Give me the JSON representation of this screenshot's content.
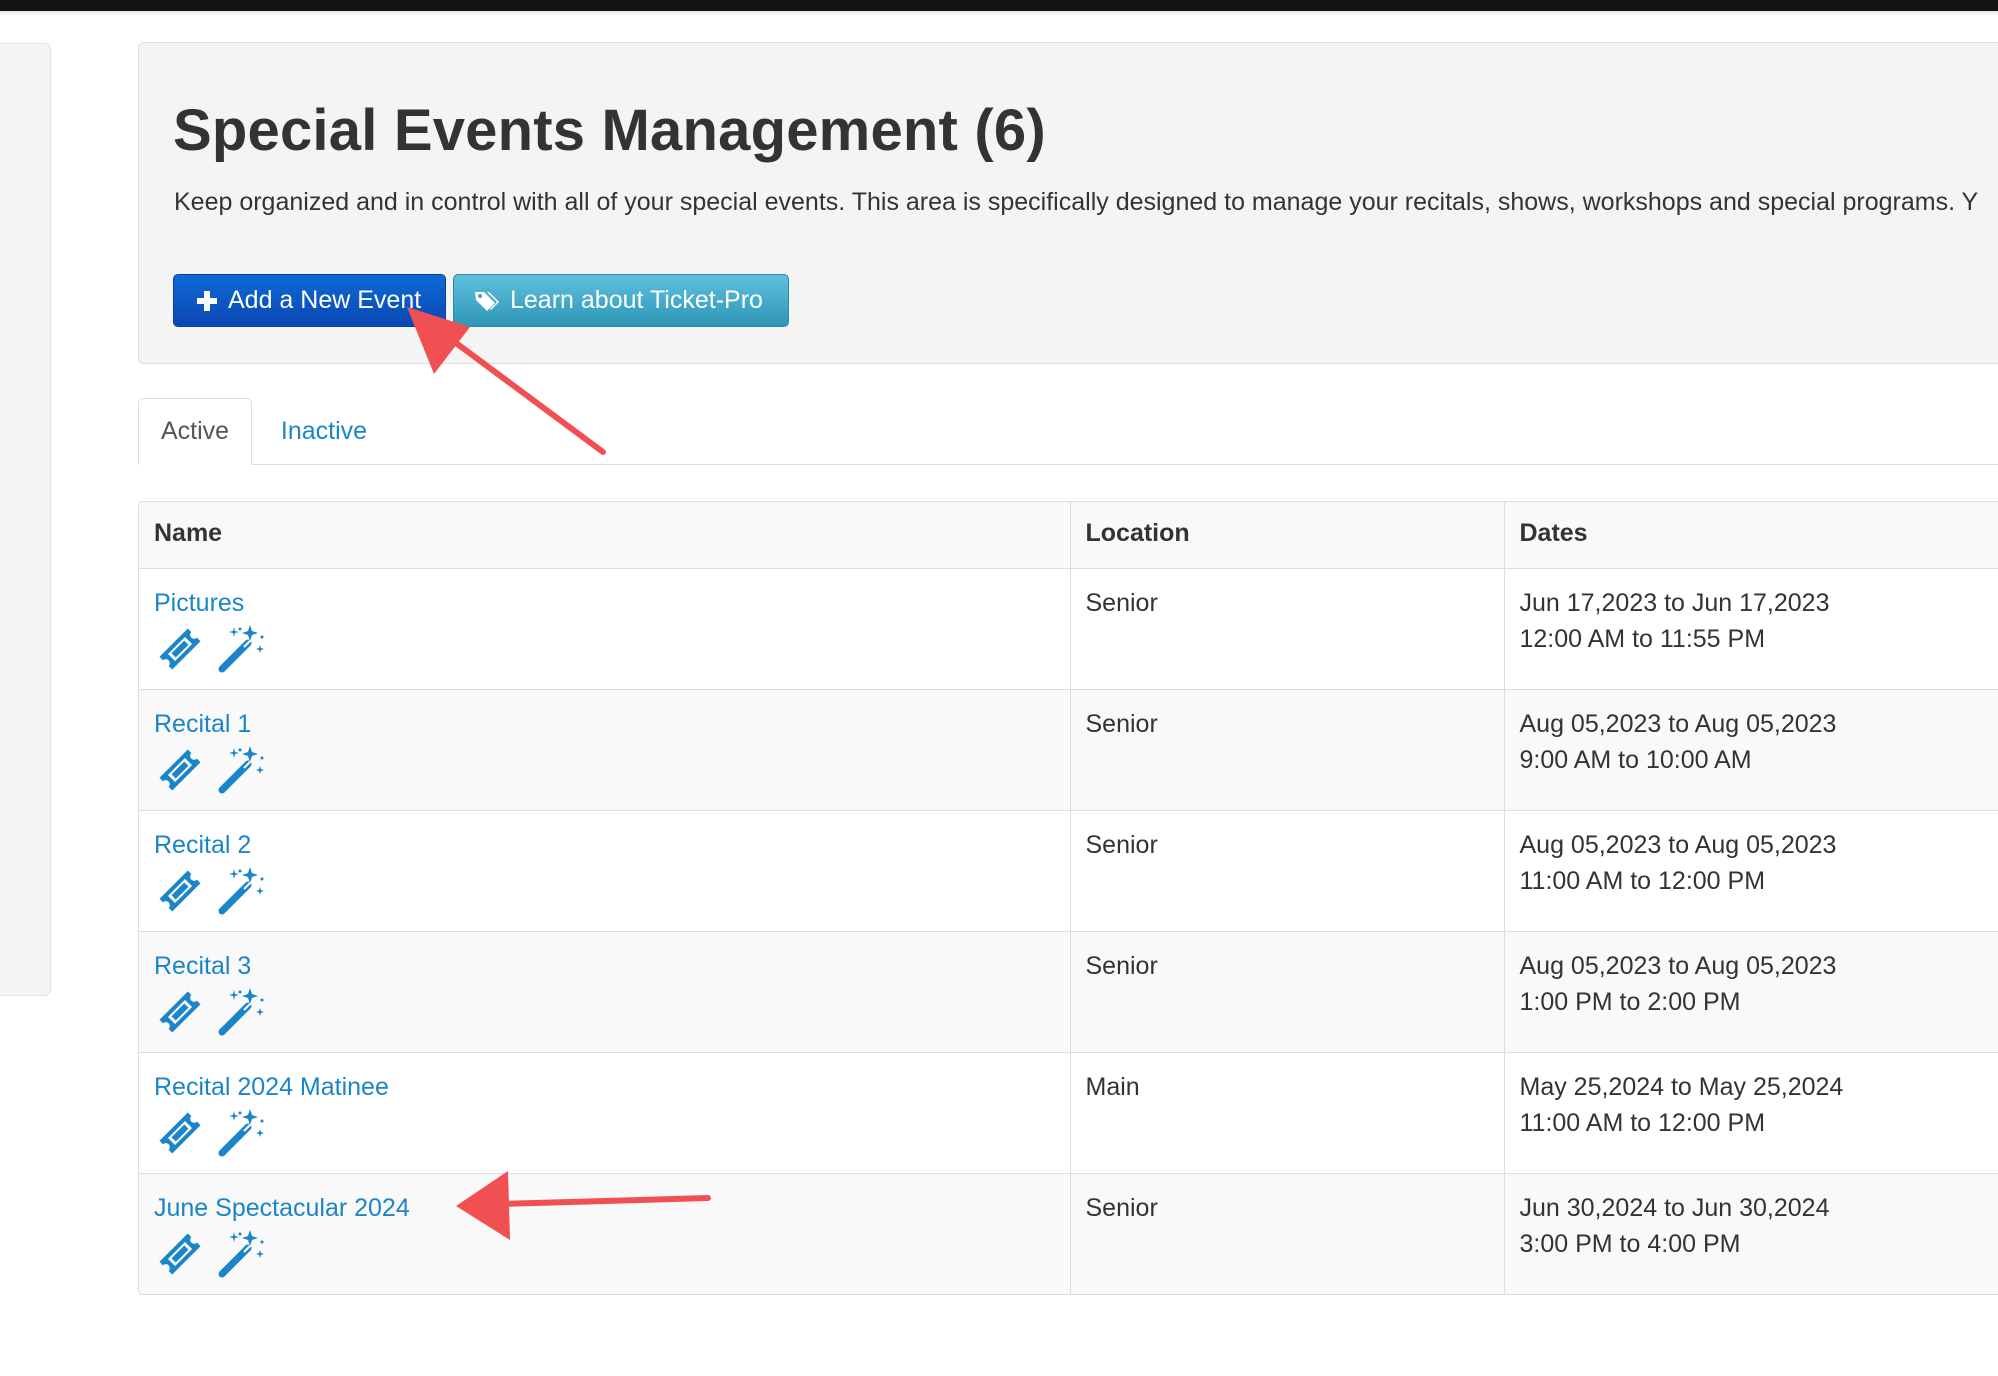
{
  "header": {
    "title": "Special Events Management (6)",
    "description": "Keep organized and in control with all of your special events. This area is specifically designed to manage your recitals, shows, workshops and special programs. Y"
  },
  "buttons": {
    "add_event": "Add a New Event",
    "learn_ticket_pro": "Learn about Ticket-Pro"
  },
  "tabs": [
    {
      "label": "Active",
      "active": true
    },
    {
      "label": "Inactive",
      "active": false
    }
  ],
  "table": {
    "columns": [
      "Name",
      "Location",
      "Dates"
    ],
    "rows": [
      {
        "name": "Pictures",
        "location": "Senior",
        "date_range": "Jun 17,2023 to Jun 17,2023",
        "time_range": "12:00 AM to 11:55 PM"
      },
      {
        "name": "Recital 1",
        "location": "Senior",
        "date_range": "Aug 05,2023 to Aug 05,2023",
        "time_range": "9:00 AM to 10:00 AM"
      },
      {
        "name": "Recital 2",
        "location": "Senior",
        "date_range": "Aug 05,2023 to Aug 05,2023",
        "time_range": "11:00 AM to 12:00 PM"
      },
      {
        "name": "Recital 3",
        "location": "Senior",
        "date_range": "Aug 05,2023 to Aug 05,2023",
        "time_range": "1:00 PM to 2:00 PM"
      },
      {
        "name": "Recital 2024 Matinee",
        "location": "Main",
        "date_range": "May 25,2024 to May 25,2024",
        "time_range": "11:00 AM to 12:00 PM"
      },
      {
        "name": "June Spectacular 2024",
        "location": "Senior",
        "date_range": "Jun 30,2024 to Jun 30,2024",
        "time_range": "3:00 PM to 4:00 PM"
      }
    ],
    "row_icons": [
      "ticket-icon",
      "magic-wand-icon"
    ]
  },
  "colors": {
    "link": "#1a85c9",
    "primary_button": "#0a57c4",
    "info_button": "#46abc9",
    "annotation_arrow": "#f05052"
  }
}
